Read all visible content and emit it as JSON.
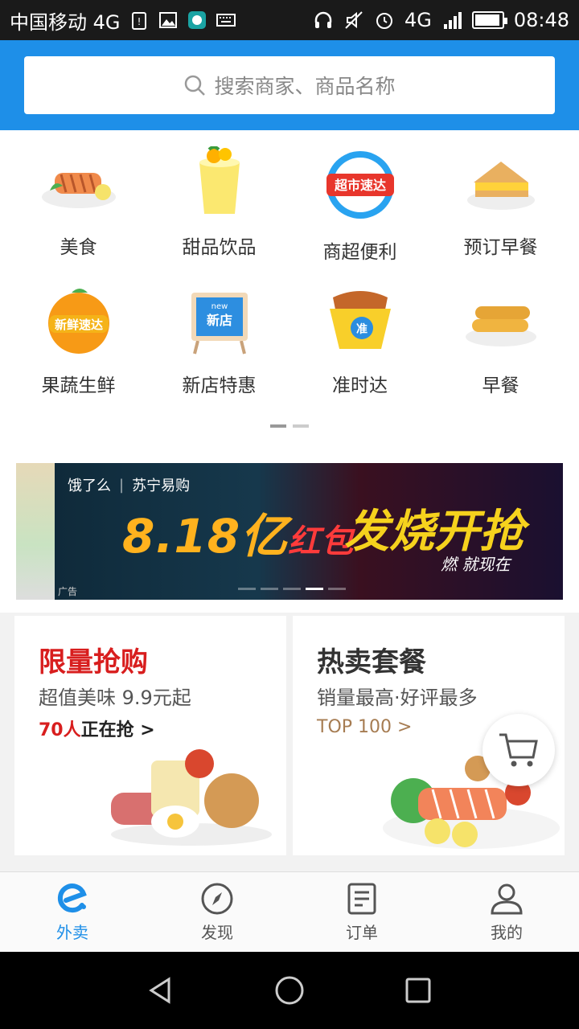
{
  "status_bar": {
    "carrier": "中国移动 4G",
    "time": "08:48",
    "network_right": "4G",
    "battery_level": 0.85
  },
  "search": {
    "placeholder": "搜索商家、商品名称"
  },
  "categories": [
    {
      "label": "美食",
      "icon": "grilled-fish-icon"
    },
    {
      "label": "甜品饮品",
      "icon": "drink-icon"
    },
    {
      "label": "商超便利",
      "icon": "supermarket-badge-icon",
      "badge_text": "超市速达"
    },
    {
      "label": "预订早餐",
      "icon": "sandwich-icon"
    },
    {
      "label": "果蔬生鲜",
      "icon": "orange-fruit-icon",
      "badge_text": "新鲜速达"
    },
    {
      "label": "新店特惠",
      "icon": "new-store-sign-icon",
      "badge_text": "新店",
      "badge_small": "new"
    },
    {
      "label": "准时达",
      "icon": "noodle-box-icon",
      "badge_text": "准"
    },
    {
      "label": "早餐",
      "icon": "bread-rolls-icon"
    }
  ],
  "category_pager": {
    "pages": 2,
    "active": 0
  },
  "banner": {
    "brand": "饿了么",
    "partner": "苏宁易购",
    "headline_num": "8.18亿",
    "headline_red": "红包",
    "slogan": "发烧开抢",
    "subline": "燃 就现在",
    "ad_label": "广告",
    "pages": 5,
    "active": 3
  },
  "promos": [
    {
      "title": "限量抢购",
      "title_color": "#d81e1e",
      "subtitle": "超值美味 9.9元起",
      "cta_num": "70人",
      "cta_text": "正在抢 >"
    },
    {
      "title": "热卖套餐",
      "title_color": "#333333",
      "subtitle": "销量最高·好评最多",
      "cta_text": "TOP 100 >"
    }
  ],
  "bottom_nav": [
    {
      "label": "外卖",
      "icon": "eleme-logo-icon",
      "active": true
    },
    {
      "label": "发现",
      "icon": "compass-icon",
      "active": false
    },
    {
      "label": "订单",
      "icon": "order-list-icon",
      "active": false
    },
    {
      "label": "我的",
      "icon": "user-icon",
      "active": false
    }
  ],
  "colors": {
    "brand_blue": "#1e8fe8",
    "promo_red": "#d81e1e",
    "top_link_brown": "#a67c52"
  }
}
